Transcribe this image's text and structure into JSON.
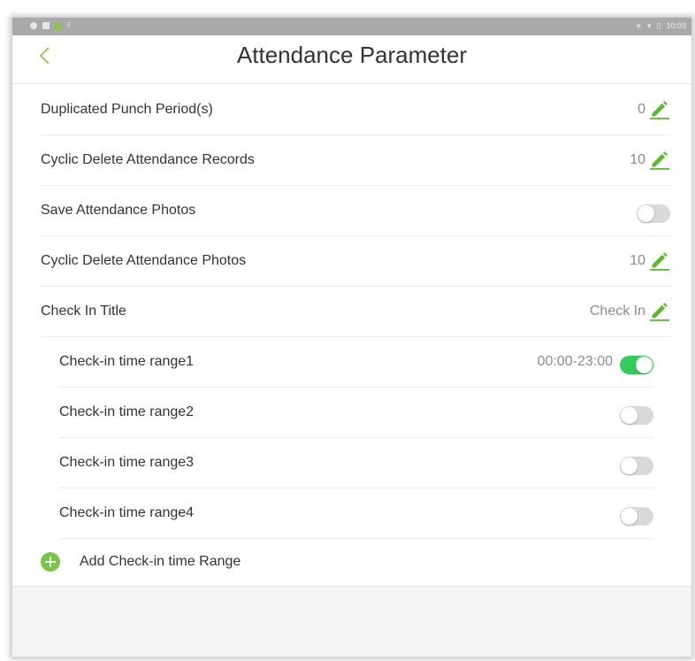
{
  "status_bar": {
    "time": "10:03",
    "left_icons": [
      "notification-dot-icon",
      "image-icon",
      "app-icon",
      "upload-icon"
    ],
    "right_icons": [
      "bluetooth-icon",
      "wifi-icon",
      "battery-icon"
    ]
  },
  "header": {
    "title": "Attendance Parameter",
    "back_icon": "chevron-left-icon"
  },
  "settings": [
    {
      "label": "Duplicated Punch Period(s)",
      "value": "0",
      "control": "edit"
    },
    {
      "label": "Cyclic Delete Attendance Records",
      "value": "10",
      "control": "edit"
    },
    {
      "label": "Save Attendance Photos",
      "value": "",
      "control": "toggle",
      "on": false
    },
    {
      "label": "Cyclic Delete Attendance Photos",
      "value": "10",
      "control": "edit"
    },
    {
      "label": "Check In Title",
      "value": "Check In",
      "control": "edit"
    }
  ],
  "time_ranges": [
    {
      "label": "Check-in time range1",
      "value": "00:00-23:00",
      "on": true
    },
    {
      "label": "Check-in time range2",
      "value": "",
      "on": false
    },
    {
      "label": "Check-in time range3",
      "value": "",
      "on": false
    },
    {
      "label": "Check-in time range4",
      "value": "",
      "on": false
    }
  ],
  "add_range": {
    "label": "Add Check-in time Range",
    "icon": "plus-circle-icon"
  },
  "colors": {
    "accent_green": "#36c95b",
    "edit_icon_green": "#5cb82f",
    "add_icon_green": "#7bc34b",
    "text": "#333333",
    "value_text": "#8c8c8c",
    "toggle_off": "#d9d9d9"
  }
}
